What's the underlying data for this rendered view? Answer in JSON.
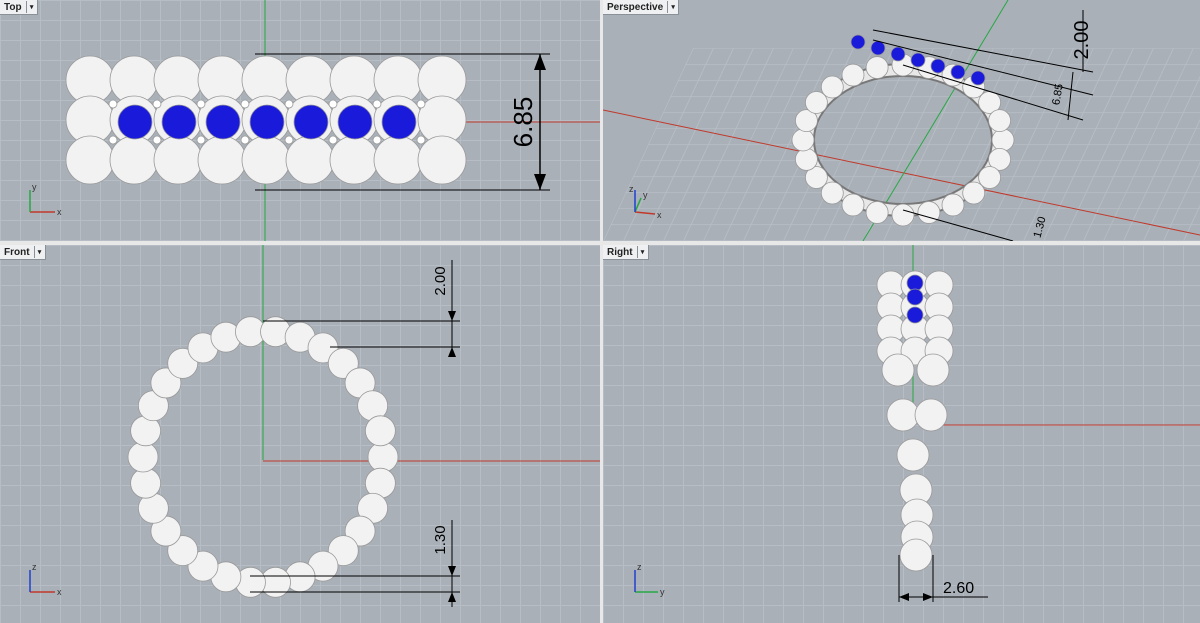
{
  "viewports": {
    "top": {
      "label": "Top"
    },
    "persp": {
      "label": "Perspective"
    },
    "front": {
      "label": "Front"
    },
    "right": {
      "label": "Right"
    }
  },
  "dropdown_icon": "▾",
  "dimensions": {
    "top_height": "6.85",
    "persp_top": "2.00",
    "persp_mid": "6.85",
    "persp_bottom": "1.30",
    "front_top": "2.00",
    "front_bottom": "1.30",
    "right_width": "2.60"
  },
  "axes": {
    "x": "x",
    "y": "y",
    "z": "z"
  },
  "colors": {
    "viewport_bg": "#a9b0b8",
    "x_axis": "#c0392b",
    "y_axis": "#27a844",
    "z_axis": "#2040d0",
    "gem": "#1a1adb",
    "bead": "#f2f2f2"
  }
}
